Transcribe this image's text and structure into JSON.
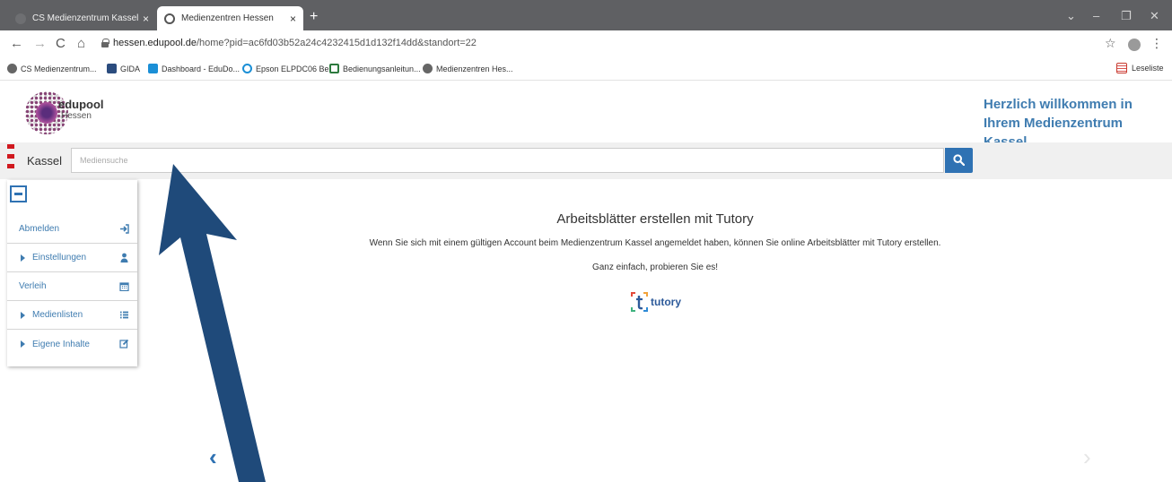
{
  "browser": {
    "tabs": [
      {
        "title": "CS Medienzentrum Kassel",
        "close": "×"
      },
      {
        "title": "Medienzentren Hessen",
        "close": "×"
      }
    ],
    "new_tab": "+",
    "window_controls": {
      "chevron": "⌄",
      "minimize": "–",
      "restore": "❐",
      "close": "✕"
    },
    "nav": {
      "back": "←",
      "forward": "→",
      "reload": "C",
      "home": "⌂"
    },
    "url_host": "hessen.edupool.de",
    "url_path": "/home?pid=ac6fd03b52a24c4232415d1d132f14dd&standort=22",
    "star": "☆",
    "kebab": "⋮",
    "bookmarks": [
      {
        "label": "CS Medienzentrum...",
        "icon": "globe-icon"
      },
      {
        "label": "GIDA",
        "icon": "gida-icon"
      },
      {
        "label": "Dashboard - EduDo...",
        "icon": "edudoc-icon"
      },
      {
        "label": "Epson ELPDC06 Be...",
        "icon": "epson-icon"
      },
      {
        "label": "Bedienungsanleitun...",
        "icon": "search-doc-icon"
      },
      {
        "label": "Medienzentren Hes...",
        "icon": "globe-icon"
      }
    ],
    "reading_list": "Leseliste"
  },
  "header": {
    "logo_name": "edupool",
    "logo_sub": "Hessen",
    "welcome": "Herzlich willkommen in Ihrem Medienzentrum Kassel"
  },
  "search": {
    "site_label": "Kassel",
    "placeholder": "Mediensuche",
    "button_icon": "search-icon"
  },
  "sidebar": {
    "items": [
      {
        "label": "Abmelden",
        "expandable": false,
        "icon": "sign-in-icon"
      },
      {
        "label": "Einstellungen",
        "expandable": true,
        "icon": "user-icon"
      },
      {
        "label": "Verleih",
        "expandable": false,
        "icon": "calendar-icon"
      },
      {
        "label": "Medienlisten",
        "expandable": true,
        "icon": "list-icon"
      },
      {
        "label": "Eigene Inhalte",
        "expandable": true,
        "icon": "edit-icon"
      }
    ]
  },
  "main": {
    "title": "Arbeitsblätter erstellen mit Tutory",
    "text": "Wenn Sie sich mit einem gültigen Account beim Medienzentrum Kassel angemeldet haben, können Sie online Arbeitsblätter mit Tutory erstellen.",
    "sub": "Ganz einfach, probieren Sie es!",
    "tutory_word": "tutory"
  },
  "carousel": {
    "prev": "‹",
    "next": "›"
  },
  "colors": {
    "accent": "#2f72b3",
    "welcome_text": "#3f7cb0",
    "annotation_arrow": "#1f4a7a",
    "brand_red": "#d0191f"
  }
}
